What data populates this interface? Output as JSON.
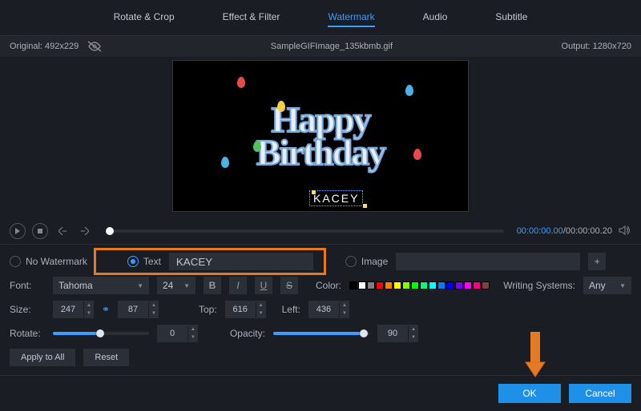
{
  "tabs": [
    "Rotate & Crop",
    "Effect & Filter",
    "Watermark",
    "Audio",
    "Subtitle"
  ],
  "active_tab": "Watermark",
  "info": {
    "original_label": "Original: 492x229",
    "filename": "SampleGIFImage_135kbmb.gif",
    "output_label": "Output: 1280x720"
  },
  "preview": {
    "line1": "Happy",
    "line2": "Birthday",
    "watermark_text": "KACEY"
  },
  "playback": {
    "current": "00:00:00.00",
    "total": "00:00:00.20"
  },
  "watermark_mode": {
    "none_label": "No Watermark",
    "text_label": "Text",
    "text_value": "KACEY",
    "image_label": "Image"
  },
  "font_row": {
    "font_label": "Font:",
    "font_family": "Tahoma",
    "font_size": "24",
    "color_label": "Color:",
    "writing_label": "Writing Systems:",
    "writing_value": "Any"
  },
  "size_row": {
    "size_label": "Size:",
    "width": "247",
    "height": "87",
    "top_label": "Top:",
    "top": "616",
    "left_label": "Left:",
    "left": "436"
  },
  "rotate_row": {
    "rotate_label": "Rotate:",
    "rotate_value": "0",
    "opacity_label": "Opacity:",
    "opacity_value": "90"
  },
  "buttons": {
    "apply_all": "Apply to All",
    "reset": "Reset",
    "ok": "OK",
    "cancel": "Cancel"
  },
  "colors": [
    "#000000",
    "#ffffff",
    "#808080",
    "#ff0000",
    "#ff8000",
    "#ffff00",
    "#80ff00",
    "#00ff00",
    "#00ff80",
    "#00ffff",
    "#0080ff",
    "#0000ff",
    "#8000ff",
    "#ff00ff",
    "#ff0080",
    "#804040"
  ]
}
